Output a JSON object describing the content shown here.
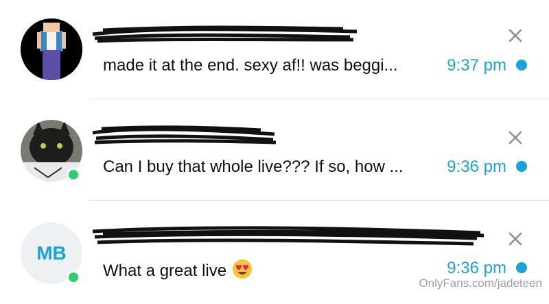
{
  "conversations": [
    {
      "preview": "made it at the end. sexy af!! was beggi...",
      "time": "9:37 pm",
      "online": false,
      "avatar_icon": "cartoon-person-avatar"
    },
    {
      "preview": "Can I buy that whole live??? If so, how ...",
      "time": "9:36 pm",
      "online": true,
      "avatar_icon": "black-cat-avatar"
    },
    {
      "preview": "What a great live",
      "time": "9:36 pm",
      "online": true,
      "avatar_initials": "MB",
      "emoji_icon": "heart-eyes-emoji-icon"
    }
  ],
  "watermark": "OnlyFans.com/jadeteen",
  "colors": {
    "accent": "#1aa3d9",
    "online": "#2ecc71",
    "text": "#111111",
    "divider": "#d9dde1"
  }
}
